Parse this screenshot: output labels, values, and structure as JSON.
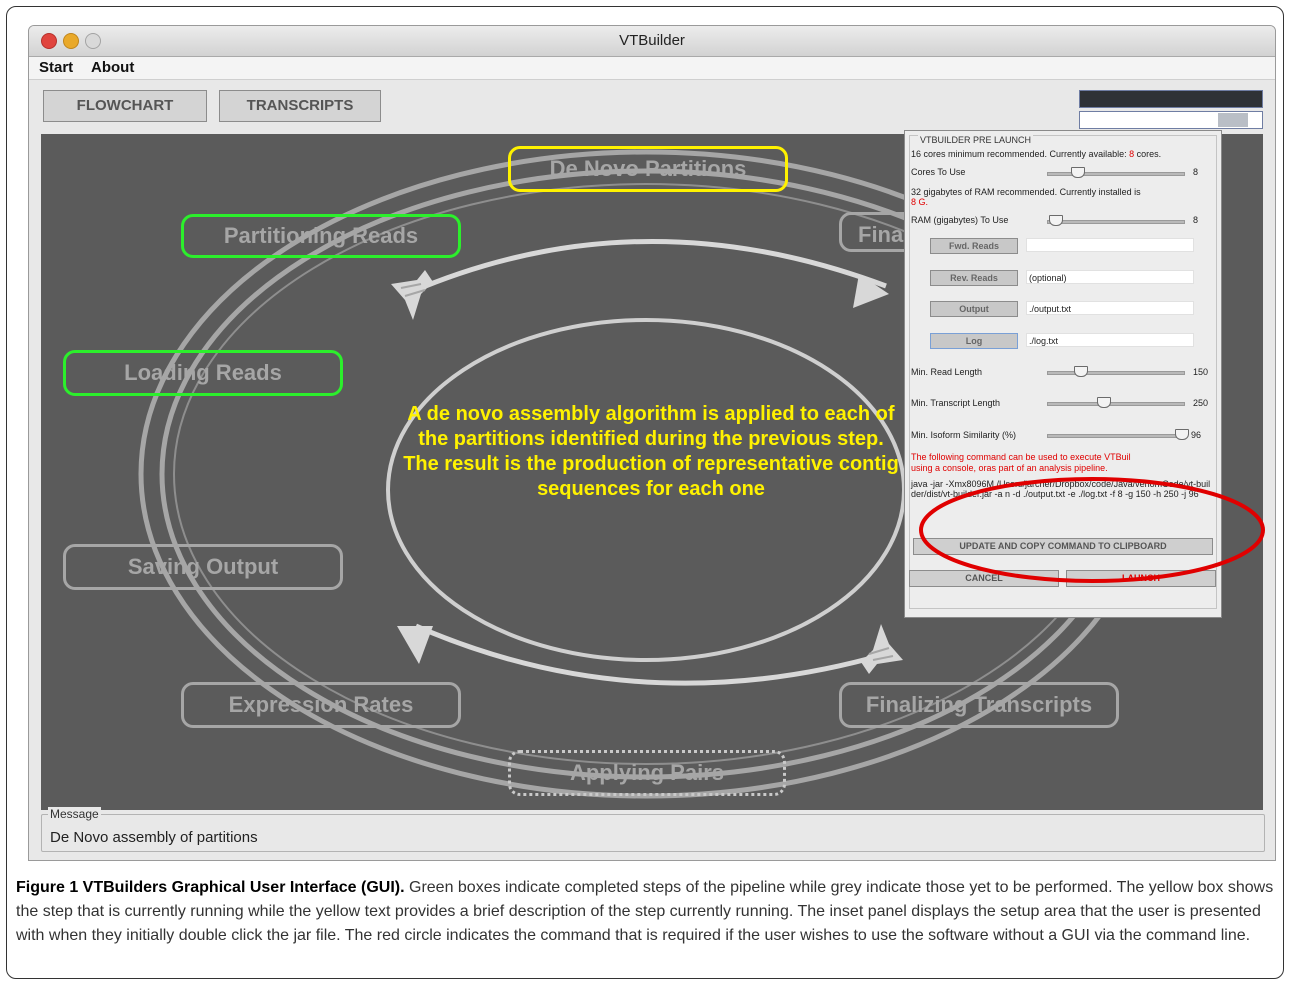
{
  "window": {
    "title": "VTBuilder",
    "menus": [
      "Start",
      "About"
    ],
    "toolbar": {
      "flowchart_label": "FLOWCHART",
      "transcripts_label": "TRANSCRIPTS"
    }
  },
  "flow": {
    "stages": {
      "de_novo": "De Novo Partitions",
      "partitioning": "Partitioning Reads",
      "finalizing_partial": "Finaliz",
      "loading": "Loading Reads",
      "saving": "Saving Output",
      "expression": "Expression Rates",
      "finalizing": "Finalizing Transcripts",
      "applying": "Applying Pairs"
    },
    "description": "A de novo assembly algorithm is applied to each of the partitions identified during the previous step. The result is the production of representative contig sequences for each one",
    "colors": {
      "completed": "#2cef2c",
      "running": "#fff200",
      "pending": "#a6a6a6",
      "highlight": "#e00000"
    }
  },
  "prelaunch": {
    "title": "VTBUILDER PRE LAUNCH",
    "cores_note": "16 cores minimum recommended. Currently available:",
    "cores_available": "8",
    "cores_suffix": "cores.",
    "cores_label": "Cores To Use",
    "cores_value": "8",
    "ram_note": "32 gigabytes of RAM recommended. Currently installed is",
    "ram_installed": "8 G.",
    "ram_label": "RAM (gigabytes) To Use",
    "ram_value": "8",
    "fwd_label": "Fwd. Reads",
    "fwd_value": "",
    "rev_label": "Rev. Reads",
    "rev_value": "(optional)",
    "output_label": "Output",
    "output_value": "./output.txt",
    "log_label": "Log",
    "log_value": "./log.txt",
    "min_read_label": "Min. Read Length",
    "min_read_value": "150",
    "min_transcript_label": "Min. Transcript Length",
    "min_transcript_value": "250",
    "min_isoform_label": "Min. Isoform Similarity (%)",
    "min_isoform_value": "96",
    "cmd_note_1": "The following command can be used to execute VTBuil",
    "cmd_note_2": "using a console, oras part of an analysis pipeline.",
    "command": "java -jar -Xmx8096M /Users/jarcher/Dropbox/code/Java/venomCode/vt-builder/dist/vt-builder.jar -a n -d ./output.txt -e ./log.txt -f 8 -g 150 -h 250 -j 96",
    "update_label": "UPDATE AND COPY COMMAND TO CLIPBOARD",
    "cancel_label": "CANCEL",
    "launch_label": "LAUNCH"
  },
  "message": {
    "label": "Message",
    "text": "De Novo assembly of partitions"
  },
  "caption": {
    "bold": "Figure 1 VTBuilders Graphical User Interface (GUI).",
    "text": " Green boxes indicate completed steps of the pipeline while grey indicate those yet to be performed. The yellow box shows the step that is currently running while the yellow text provides a brief description of the step currently running. The inset panel displays the setup area that the user is presented with when they initially double click the jar file. The red circle indicates the command that is required if the user wishes to use the software without a GUI via the command line."
  }
}
